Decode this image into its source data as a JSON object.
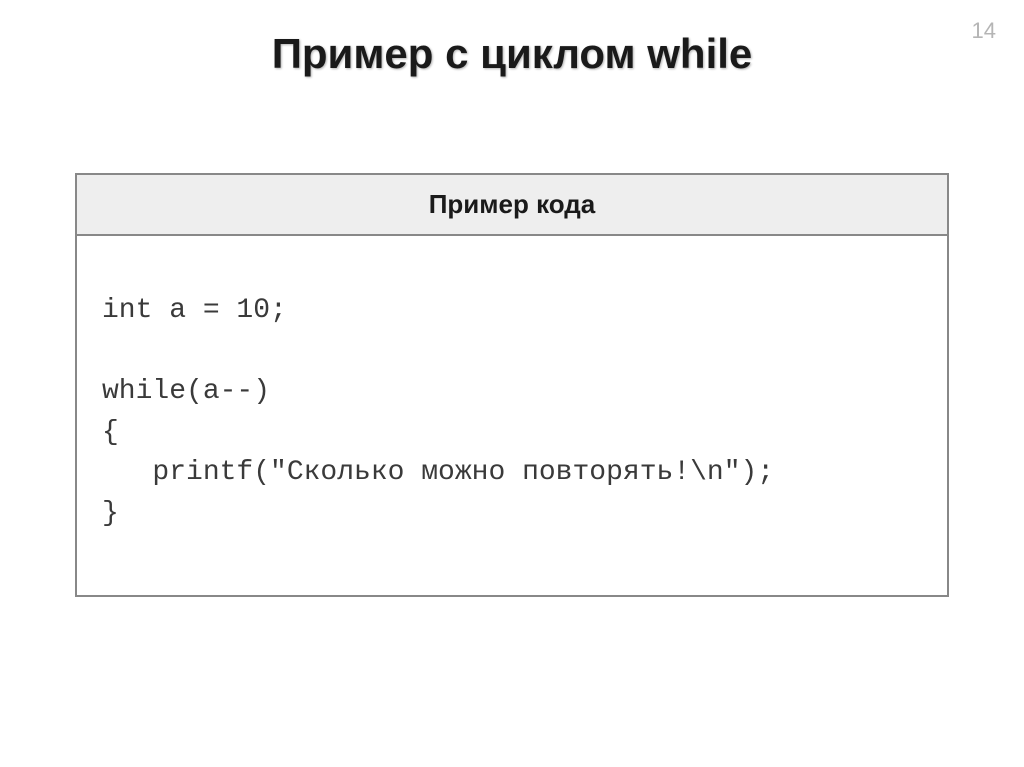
{
  "page_number": "14",
  "title": "Пример с циклом while",
  "table": {
    "header": "Пример кода",
    "code": "int a = 10;\n\nwhile(a--)\n{\n   printf(\"Сколько можно повторять!\\n\");\n}"
  }
}
